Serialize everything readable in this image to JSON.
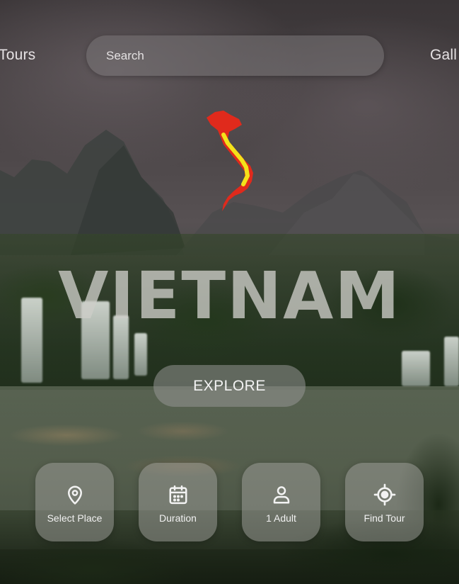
{
  "nav": {
    "left_link": "Tours",
    "right_link": "Gall"
  },
  "search": {
    "placeholder": "Search"
  },
  "hero": {
    "title": "VIETNAM",
    "cta_label": "EXPLORE",
    "map_colors": {
      "land": "#e02a1c",
      "stripe": "#f4e21a"
    }
  },
  "tiles": [
    {
      "label": "Select Place",
      "icon": "map-pin-icon"
    },
    {
      "label": "Duration",
      "icon": "calendar-icon"
    },
    {
      "label": "1 Adult",
      "icon": "person-icon"
    },
    {
      "label": "Find Tour",
      "icon": "crosshair-icon"
    }
  ]
}
